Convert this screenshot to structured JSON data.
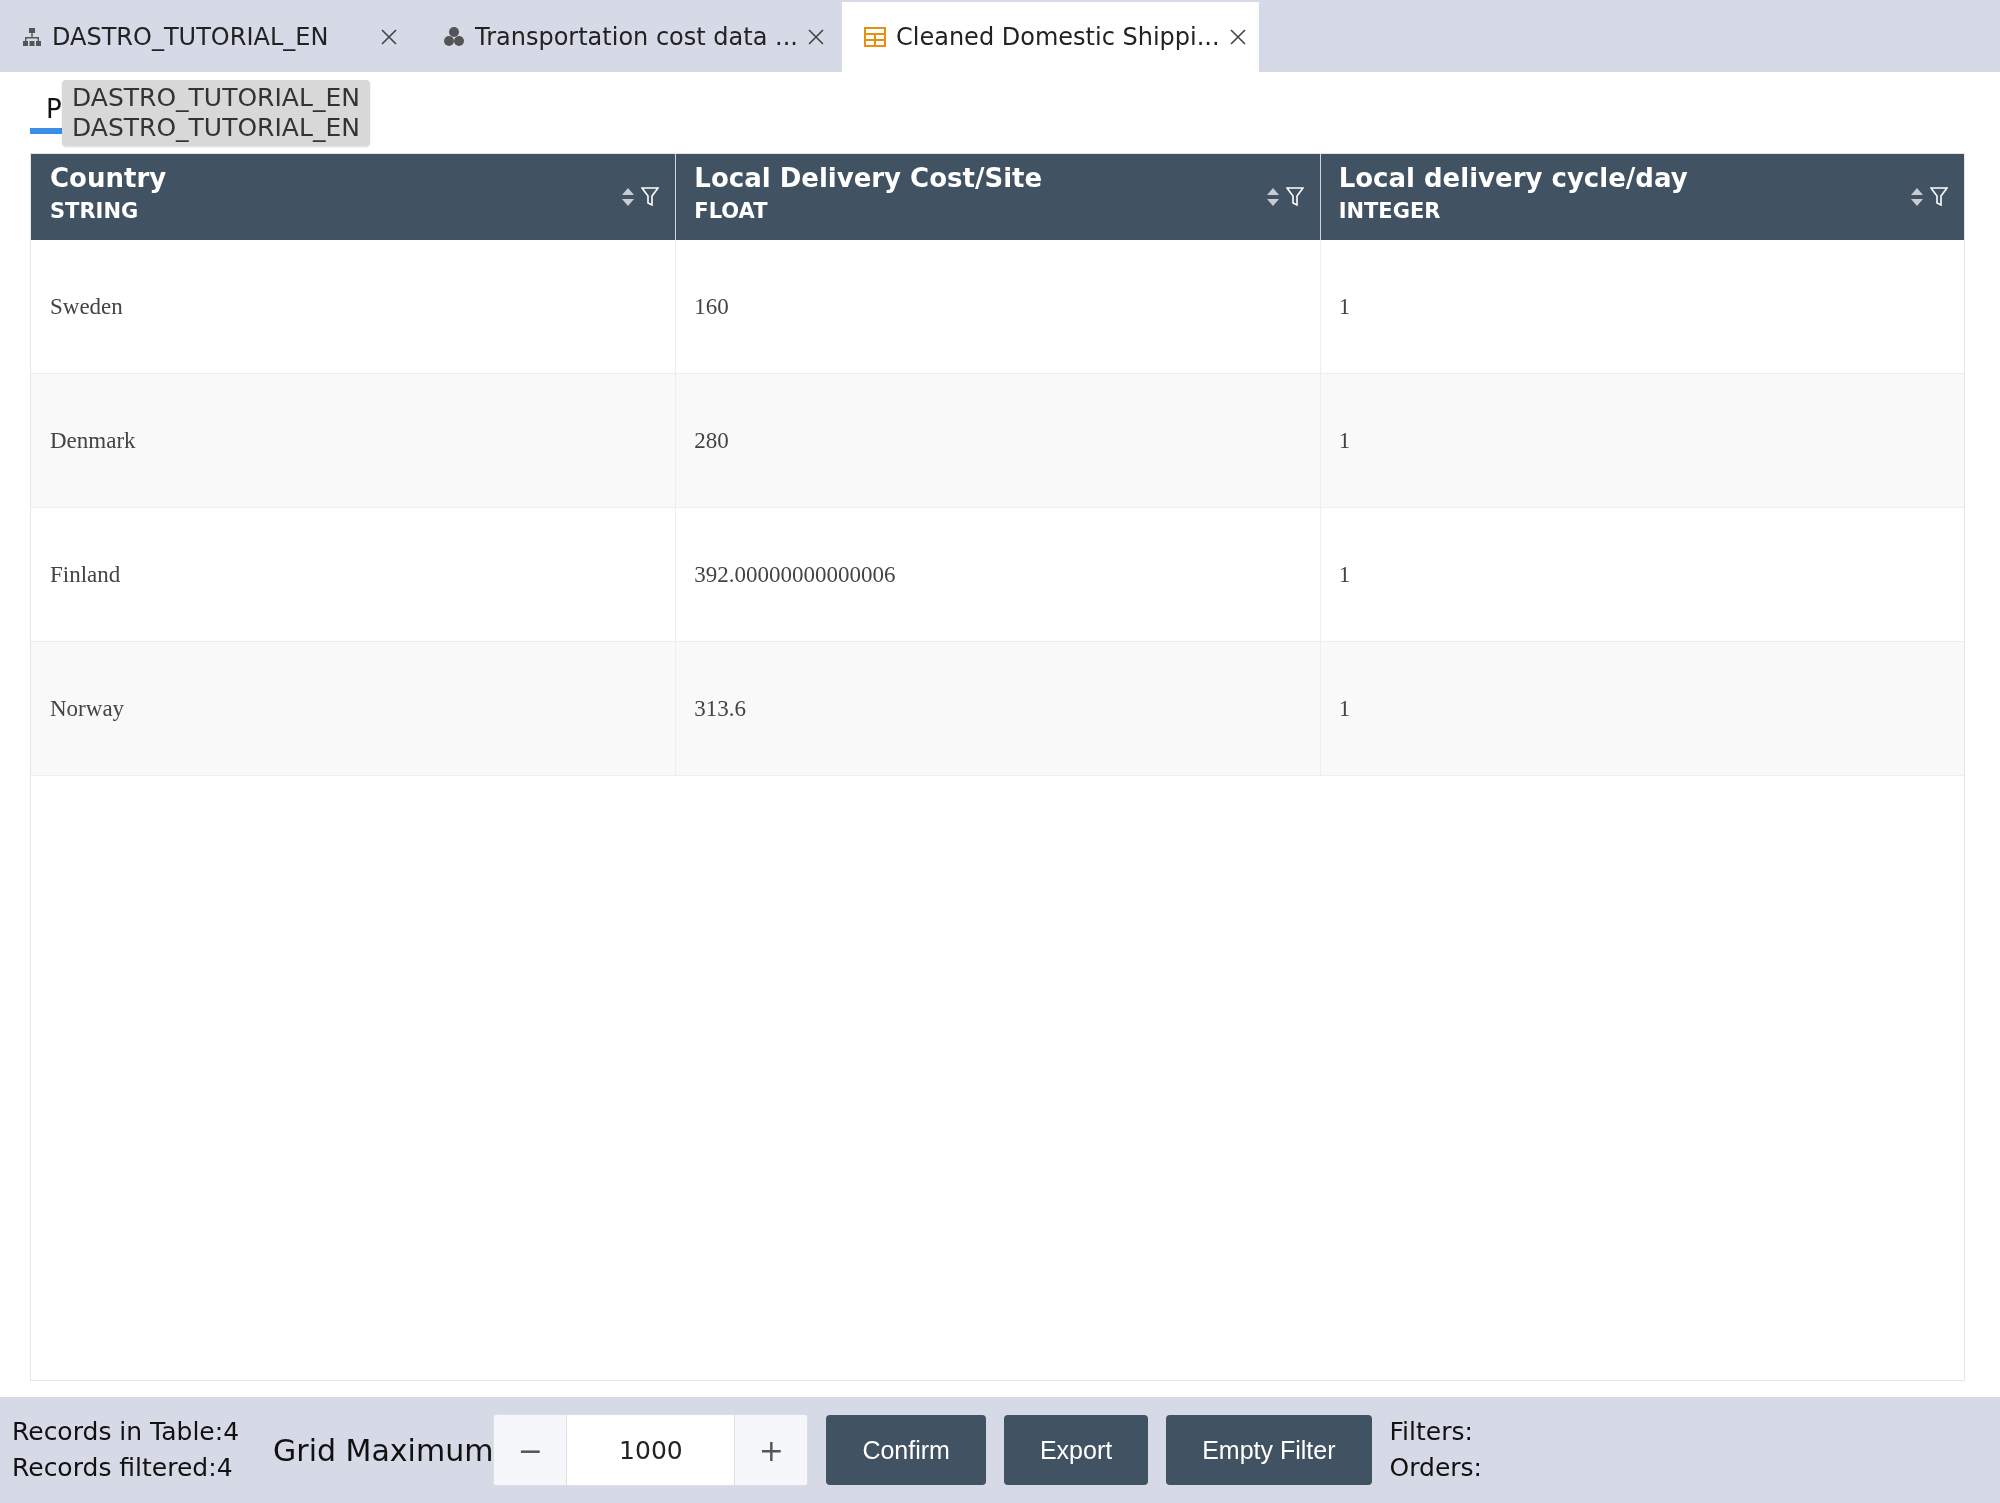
{
  "tabs": [
    {
      "label": "DASTRO_TUTORIAL_EN",
      "kind": "tree",
      "selected": false
    },
    {
      "label": "Transportation cost data ...",
      "kind": "cluster",
      "selected": false
    },
    {
      "label": "Cleaned Domestic Shippi...",
      "kind": "table",
      "selected": true
    }
  ],
  "subtabs": [
    {
      "label": "P",
      "selected": true
    }
  ],
  "tooltip": {
    "lines": [
      "DASTRO_TUTORIAL_EN",
      "DASTRO_TUTORIAL_EN"
    ]
  },
  "table": {
    "columns": [
      {
        "name": "Country",
        "type": "STRING"
      },
      {
        "name": "Local Delivery Cost/Site",
        "type": "FLOAT"
      },
      {
        "name": "Local delivery cycle/day",
        "type": "INTEGER"
      }
    ],
    "rows": [
      [
        "Sweden",
        "160",
        "1"
      ],
      [
        "Denmark",
        "280",
        "1"
      ],
      [
        "Finland",
        "392.00000000000006",
        "1"
      ],
      [
        "Norway",
        "313.6",
        "1"
      ]
    ]
  },
  "footer": {
    "records_in_table": "Records in Table:4",
    "records_filtered": "Records filtered:4",
    "grid_label": "Grid Maximum",
    "grid_value": "1000",
    "minus": "−",
    "plus": "+",
    "buttons": [
      "Confirm",
      "Export",
      "Empty Filter"
    ],
    "filters": "Filters:",
    "orders": "Orders:"
  }
}
